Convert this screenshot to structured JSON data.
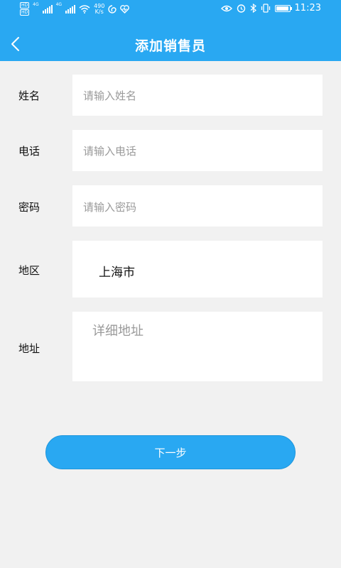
{
  "status_bar": {
    "network_speed_value": "490",
    "network_speed_unit": "K/s",
    "time": "11:23",
    "signal_label_1": "4G",
    "signal_label_2": "4G",
    "hd_label": "HD"
  },
  "header": {
    "title": "添加销售员"
  },
  "form": {
    "name": {
      "label": "姓名",
      "placeholder": "请输入姓名"
    },
    "phone": {
      "label": "电话",
      "placeholder": "请输入电话"
    },
    "password": {
      "label": "密码",
      "placeholder": "请输入密码"
    },
    "region": {
      "label": "地区",
      "value": "上海市"
    },
    "address": {
      "label": "地址",
      "placeholder": "详细地址"
    }
  },
  "next_button": {
    "label": "下一步"
  },
  "colors": {
    "accent": "#29a8f2",
    "background": "#f1f1f1"
  },
  "icons": [
    "back-arrow-icon",
    "eye-icon",
    "alarm-icon",
    "bluetooth-icon",
    "vibrate-icon",
    "battery-icon",
    "wifi-icon",
    "signal-icon"
  ]
}
